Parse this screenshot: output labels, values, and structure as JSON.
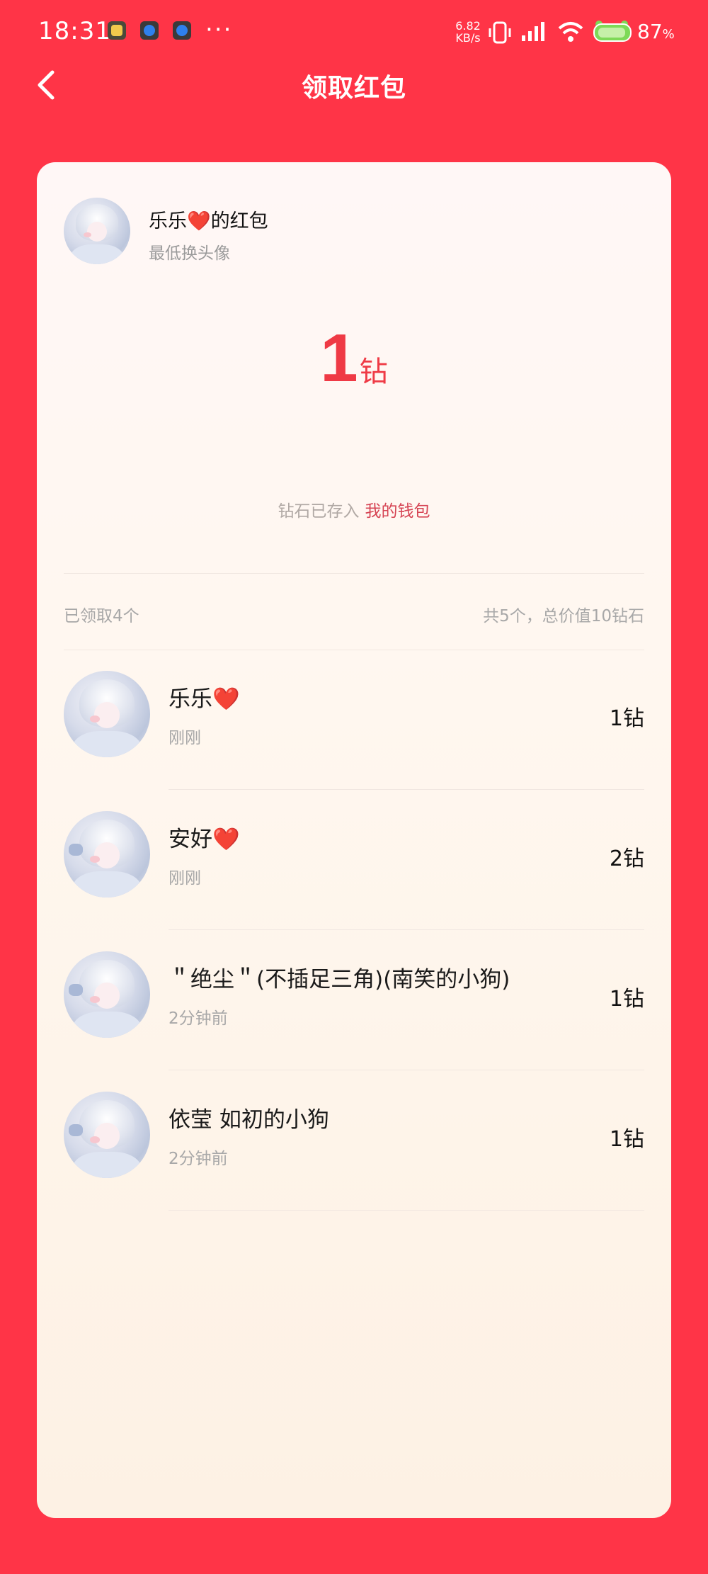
{
  "status_bar": {
    "time": "18:31",
    "more": "···",
    "net_speed_value": "6.82",
    "net_speed_unit": "KB/s",
    "battery_value": "87",
    "battery_unit": "%"
  },
  "header": {
    "title": "领取红包"
  },
  "packet": {
    "sender_name": "乐乐",
    "sender_heart": "❤️",
    "sender_suffix": "的红包",
    "subtitle": "最低换头像",
    "amount": "1",
    "amount_unit": "钻",
    "wallet_text": "钻石已存入",
    "wallet_link": "我的钱包"
  },
  "summary": {
    "claimed": "已领取4个",
    "total": "共5个，总价值10钻石"
  },
  "claims": [
    {
      "name": "乐乐",
      "heart": "❤️",
      "time": "刚刚",
      "amount": "1钻"
    },
    {
      "name": "安好",
      "heart": "❤️",
      "time": "刚刚",
      "amount": "2钻"
    },
    {
      "name": "＂绝尘＂(不插足三角)(南笑的小狗)",
      "heart": "",
      "time": "2分钟前",
      "amount": "1钻"
    },
    {
      "name": "依莹 如初的小狗",
      "heart": "",
      "time": "2分钟前",
      "amount": "1钻"
    }
  ],
  "colors": {
    "background": "#ff3447",
    "amount": "#ef3a45",
    "wallet_link": "#d64454"
  }
}
